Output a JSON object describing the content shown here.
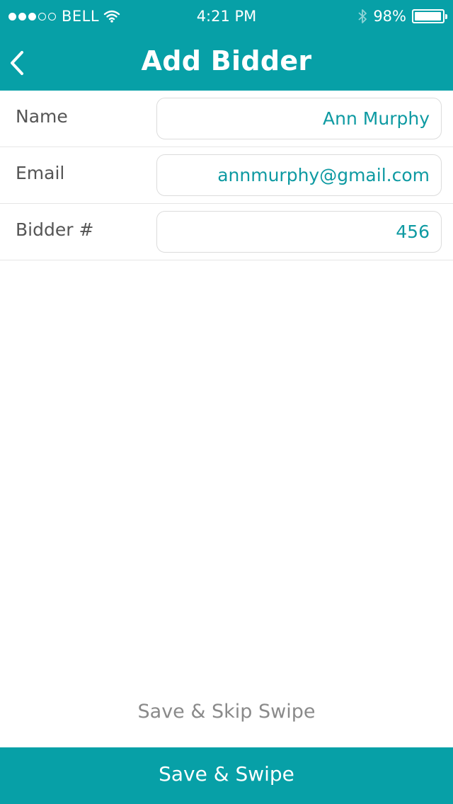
{
  "status_bar": {
    "carrier": "BELL",
    "time": "4:21 PM",
    "battery_percent": "98%",
    "battery_level": 0.98,
    "signal_strength": {
      "filled": 3,
      "total": 5
    },
    "icons": [
      "signal-dots-icon",
      "wifi-icon",
      "bluetooth-icon",
      "battery-icon"
    ]
  },
  "header": {
    "title": "Add Bidder",
    "back_icon": "chevron-left-icon"
  },
  "form": {
    "rows": [
      {
        "label": "Name",
        "value": "Ann Murphy"
      },
      {
        "label": "Email",
        "value": "annmurphy@gmail.com"
      },
      {
        "label": "Bidder #",
        "value": "456"
      }
    ]
  },
  "actions": {
    "secondary_label": "Save & Skip Swipe",
    "primary_label": "Save & Swipe"
  },
  "colors": {
    "accent": "#07a0a7",
    "value_text": "#0e9aa2",
    "label_text": "#555555",
    "secondary_text": "#8a8a8a"
  }
}
